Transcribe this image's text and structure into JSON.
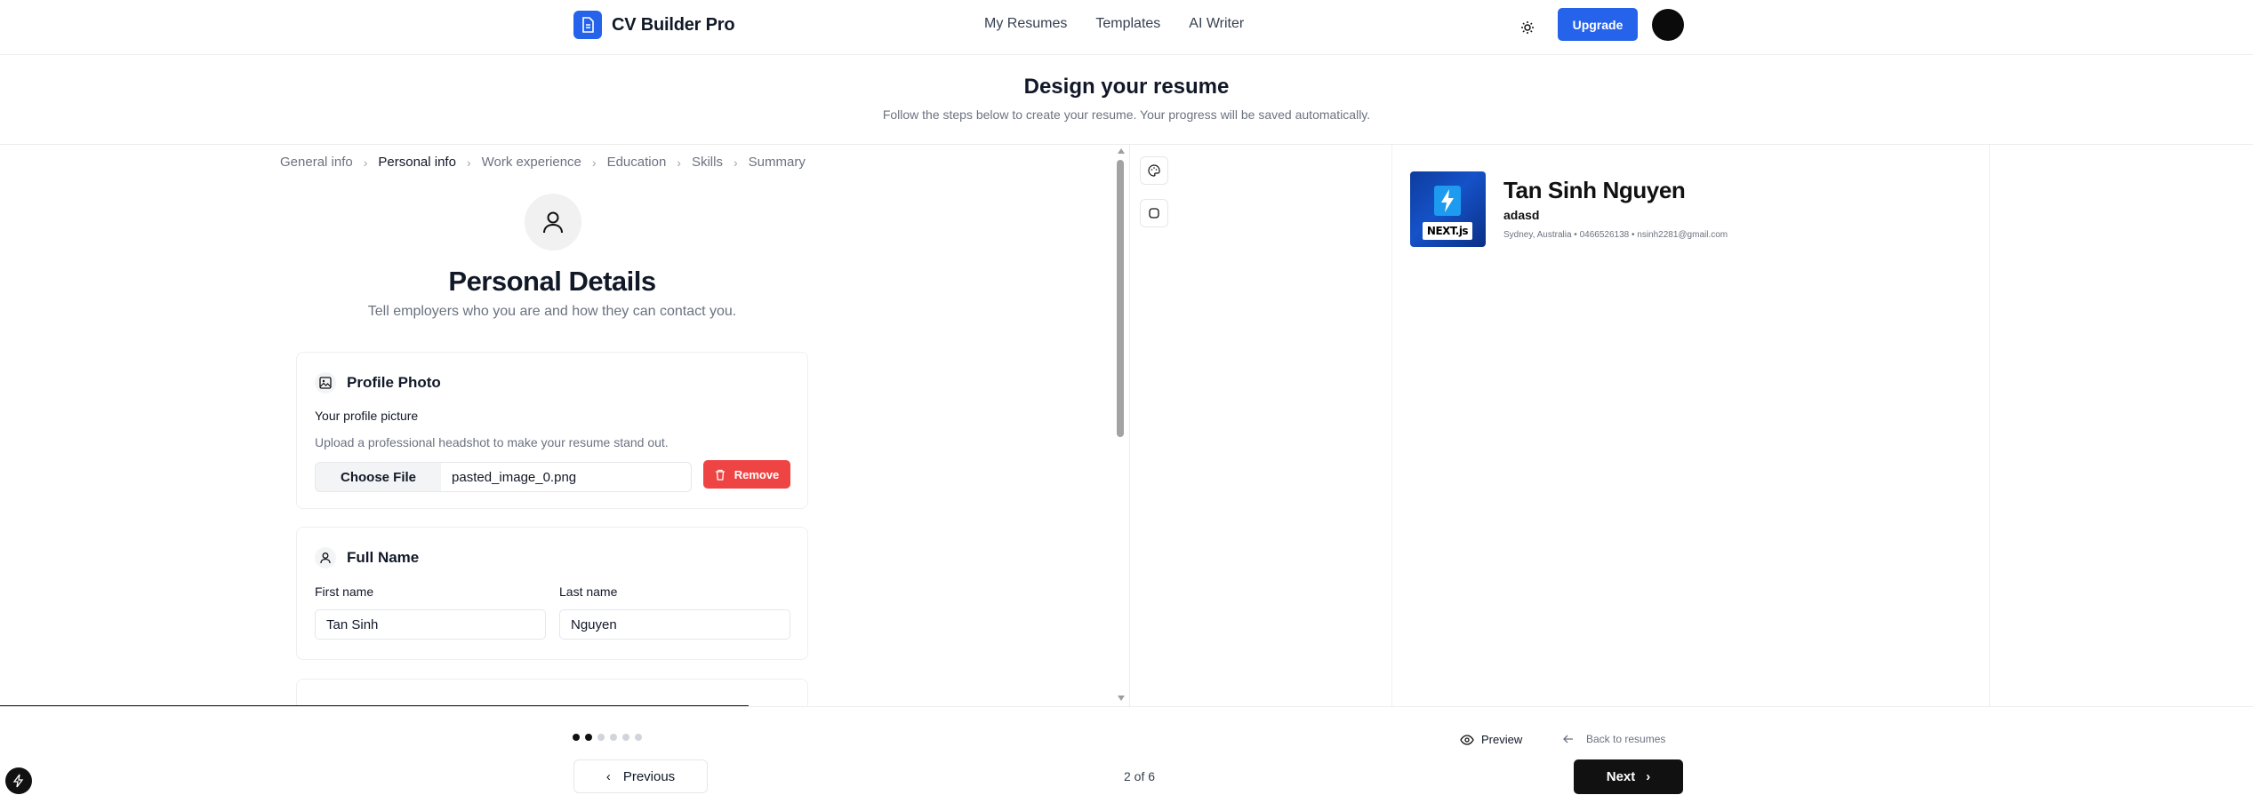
{
  "header": {
    "brand": "CV Builder Pro",
    "brand_icon": "document-icon",
    "nav": [
      "My Resumes",
      "Templates",
      "AI Writer"
    ],
    "theme_icon": "sun-icon",
    "upgrade_label": "Upgrade",
    "accent": "#2563eb"
  },
  "intro": {
    "title": "Design your resume",
    "subtitle": "Follow the steps below to create your resume. Your progress will be saved automatically."
  },
  "steps": [
    "General info",
    "Personal info",
    "Work experience",
    "Education",
    "Skills",
    "Summary"
  ],
  "active_step": 1,
  "personal": {
    "title": "Personal Details",
    "subtitle": "Tell employers who you are and how they can contact you.",
    "photo": {
      "title": "Profile Photo",
      "label": "Your profile picture",
      "hint": "Upload a professional headshot to make your resume stand out.",
      "choose_label": "Choose File",
      "file_name": "pasted_image_0.png",
      "remove_label": "Remove"
    },
    "full_name": {
      "title": "Full Name",
      "first_label": "First name",
      "first_value": "Tan Sinh",
      "last_label": "Last name",
      "last_value": "Nguyen"
    }
  },
  "resume_preview": {
    "name": "Tan Sinh Nguyen",
    "role": "adasd",
    "contact": "Sydney, Australia • 0466526138 • nsinh2281@gmail.com",
    "photo_badge": "NEXT.js"
  },
  "footer": {
    "prev_label": "Previous",
    "page_count": "2 of 6",
    "preview_label": "Preview",
    "back_label": "Back to resumes",
    "next_label": "Next",
    "steps_total": 6,
    "steps_done": 2
  }
}
